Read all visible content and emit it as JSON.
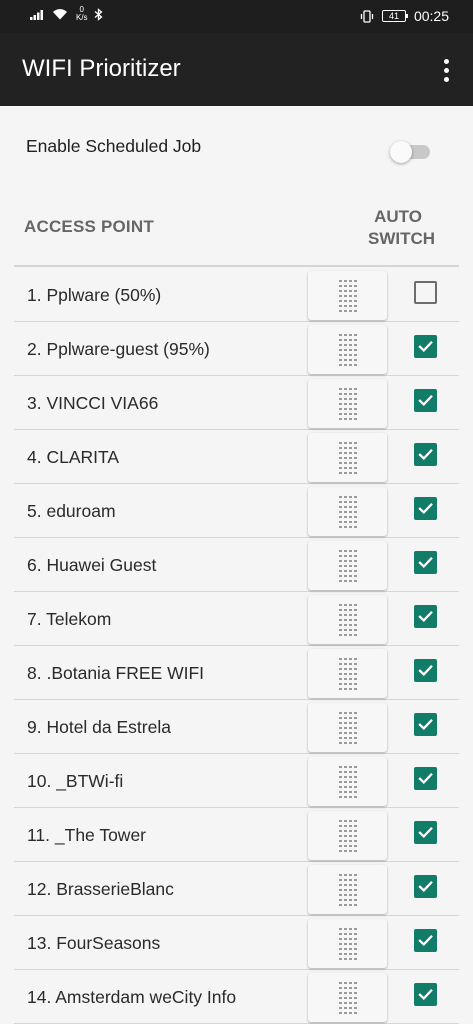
{
  "status_bar": {
    "net_speed_value": "0",
    "net_speed_unit": "K/s",
    "battery": "41",
    "time": "00:25"
  },
  "app_bar": {
    "title": "WIFI Prioritizer"
  },
  "schedule": {
    "label": "Enable Scheduled Job",
    "enabled": false
  },
  "columns": {
    "access_point": "ACCESS POINT",
    "auto_line1": "AUTO",
    "auto_line2": "SWITCH"
  },
  "access_points": [
    {
      "label": "1. Pplware (50%)",
      "auto_switch": false
    },
    {
      "label": "2. Pplware-guest (95%)",
      "auto_switch": true
    },
    {
      "label": "3. VINCCI VIA66",
      "auto_switch": true
    },
    {
      "label": "4. CLARITA",
      "auto_switch": true
    },
    {
      "label": "5. eduroam",
      "auto_switch": true
    },
    {
      "label": "6. Huawei Guest",
      "auto_switch": true
    },
    {
      "label": "7. Telekom",
      "auto_switch": true
    },
    {
      "label": "8. .Botania FREE WIFI",
      "auto_switch": true
    },
    {
      "label": "9. Hotel da Estrela",
      "auto_switch": true
    },
    {
      "label": "10. _BTWi-fi",
      "auto_switch": true
    },
    {
      "label": "11. _The Tower",
      "auto_switch": true
    },
    {
      "label": "12. BrasserieBlanc",
      "auto_switch": true
    },
    {
      "label": "13. FourSeasons",
      "auto_switch": true
    },
    {
      "label": "14. Amsterdam weCity Info",
      "auto_switch": true
    }
  ],
  "colors": {
    "app_bar": "#222222",
    "checkbox_checked": "#117c67",
    "background": "#f5f5f5"
  },
  "icons": {
    "signal": "signal-icon",
    "wifi": "wifi-icon",
    "bluetooth": "bluetooth-icon",
    "vibrate": "vibrate-icon",
    "drag": "drag-handle-icon",
    "menu": "more-vert-icon"
  }
}
